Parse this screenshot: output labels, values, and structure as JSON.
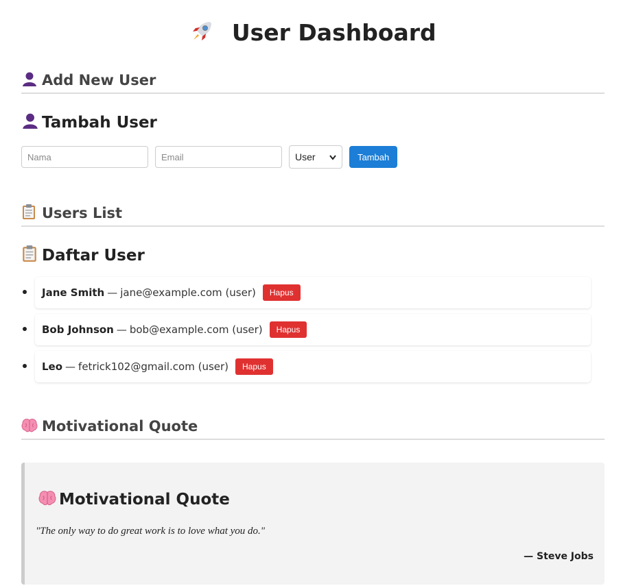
{
  "header": {
    "title": "User Dashboard",
    "icon": "rocket-icon"
  },
  "add_section": {
    "heading": "Add New User",
    "subheading": "Tambah User",
    "icon": "user-silhouette-icon",
    "name_placeholder": "Nama",
    "email_placeholder": "Email",
    "role_selected": "User",
    "submit_label": "Tambah",
    "accent_color": "#1c7ed6"
  },
  "users_section": {
    "heading": "Users List",
    "subheading": "Daftar User",
    "icon": "clipboard-icon",
    "separator": "—",
    "delete_label": "Hapus",
    "delete_color": "#e03131",
    "users": [
      {
        "name": "Jane Smith",
        "email": "jane@example.com",
        "role": "(user)"
      },
      {
        "name": "Bob Johnson",
        "email": "bob@example.com",
        "role": "(user)"
      },
      {
        "name": "Leo",
        "email": "fetrick102@gmail.com",
        "role": "(user)"
      }
    ]
  },
  "quote_section": {
    "heading": "Motivational Quote",
    "subheading": "Motivational Quote",
    "icon": "brain-icon",
    "quote": "\"The only way to do great work is to love what you do.\"",
    "author": "— Steve Jobs"
  }
}
